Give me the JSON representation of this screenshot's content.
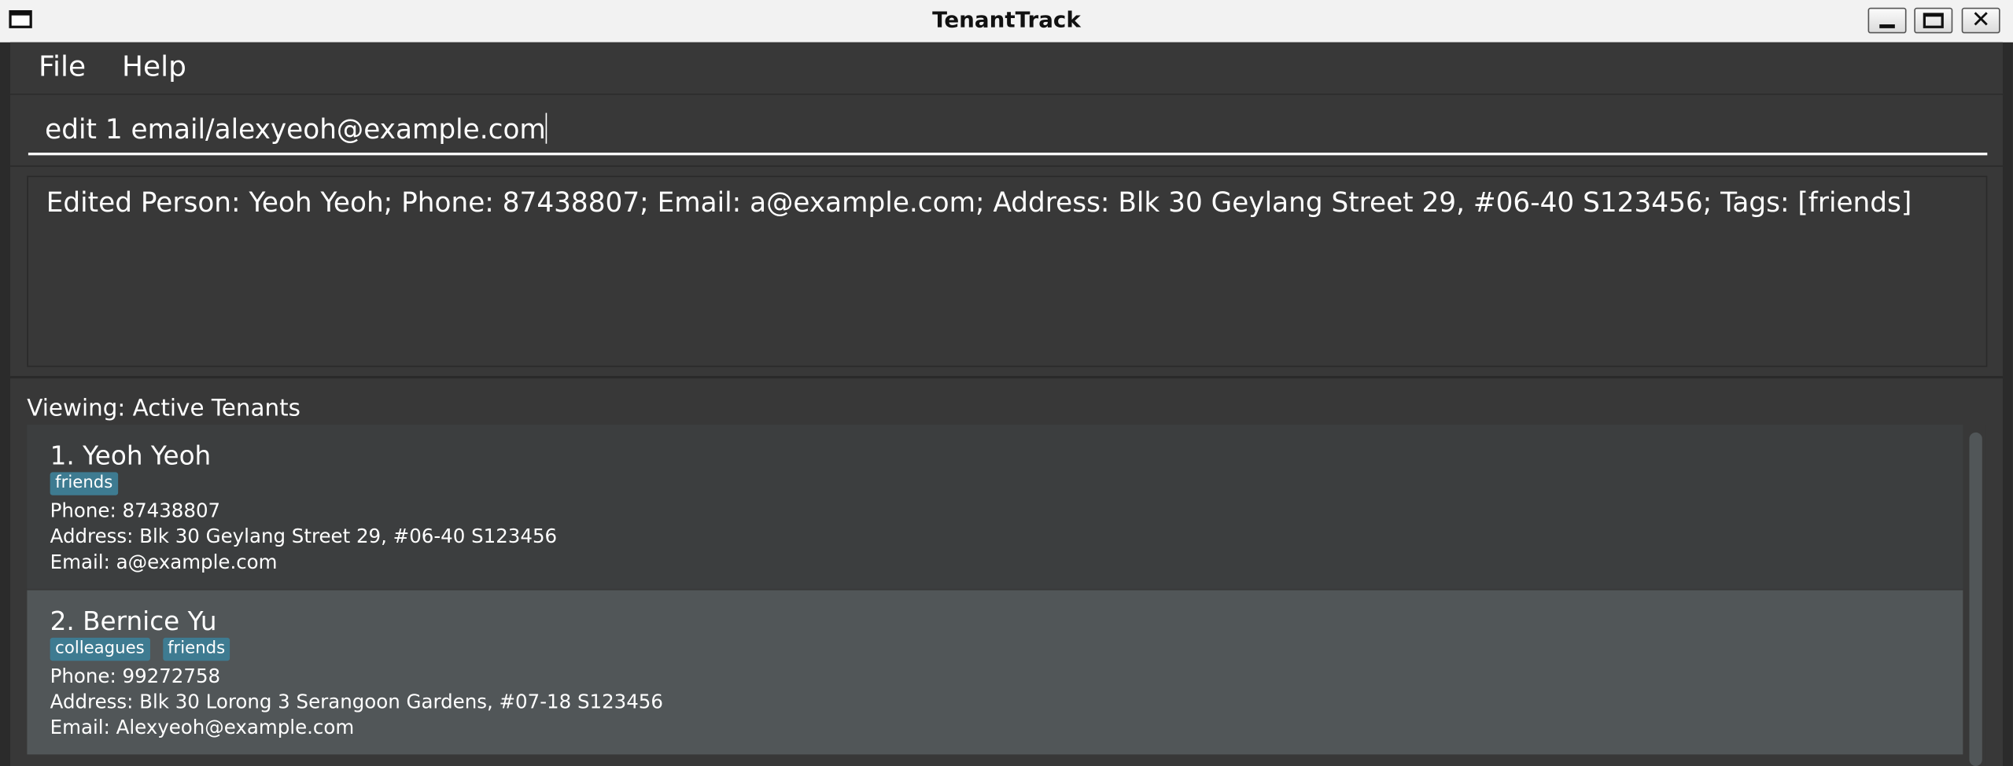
{
  "window": {
    "title": "TenantTrack"
  },
  "menu": {
    "file": "File",
    "help": "Help"
  },
  "command": {
    "value": "edit 1 email/alexyeoh@example.com"
  },
  "result": {
    "text": "Edited Person: Yeoh Yeoh; Phone: 87438807; Email: a@example.com; Address: Blk 30 Geylang Street 29, #06-40 S123456; Tags: [friends]"
  },
  "list": {
    "viewing_label": "Viewing: Active Tenants",
    "persons": [
      {
        "name": "1. Yeoh Yeoh",
        "tags": [
          "friends"
        ],
        "phone": "Phone: 87438807",
        "address": "Address: Blk 30 Geylang Street 29, #06-40 S123456",
        "email": "Email: a@example.com"
      },
      {
        "name": "2. Bernice Yu",
        "tags": [
          "colleagues",
          "friends"
        ],
        "phone": "Phone: 99272758",
        "address": "Address: Blk 30 Lorong 3 Serangoon Gardens, #07-18 S123456",
        "email": "Email: Alexyeoh@example.com"
      }
    ]
  },
  "colors": {
    "background": "#383838",
    "card_default": "#3c3e3f",
    "card_selected": "#515658",
    "tag": "#3e7b91",
    "text": "#ffffff"
  },
  "icons": {
    "window": "window-icon",
    "minimize": "minimize-icon",
    "maximize": "maximize-icon",
    "close": "close-icon"
  }
}
